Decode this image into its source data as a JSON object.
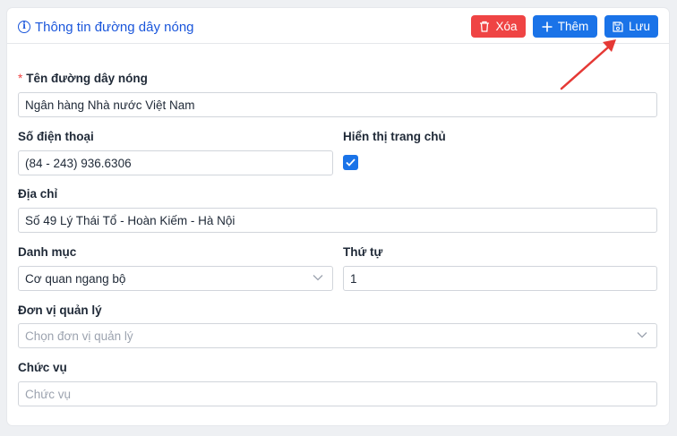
{
  "header": {
    "title": "Thông tin đường dây nóng",
    "buttons": {
      "delete": "Xóa",
      "add": "Thêm",
      "save": "Lưu"
    }
  },
  "form": {
    "hotline_name": {
      "label": "Tên đường dây nóng",
      "required_mark": "*",
      "value": "Ngân hàng Nhà nước Việt Nam"
    },
    "phone": {
      "label": "Số điện thoại",
      "value": "(84 - 243) 936.6306"
    },
    "show_home": {
      "label": "Hiển thị trang chủ",
      "checked": true
    },
    "address": {
      "label": "Địa chỉ",
      "value": "Số 49 Lý Thái Tổ - Hoàn Kiếm - Hà Nội"
    },
    "category": {
      "label": "Danh mục",
      "value": "Cơ quan ngang bộ"
    },
    "order": {
      "label": "Thứ tự",
      "value": "1"
    },
    "unit": {
      "label": "Đơn vị quản lý",
      "placeholder": "Chọn đơn vị quản lý"
    },
    "position": {
      "label": "Chức vụ",
      "placeholder": "Chức vụ"
    }
  },
  "colors": {
    "primary": "#1a73e8",
    "danger": "#ef4444",
    "annotation_arrow": "#e53935"
  }
}
